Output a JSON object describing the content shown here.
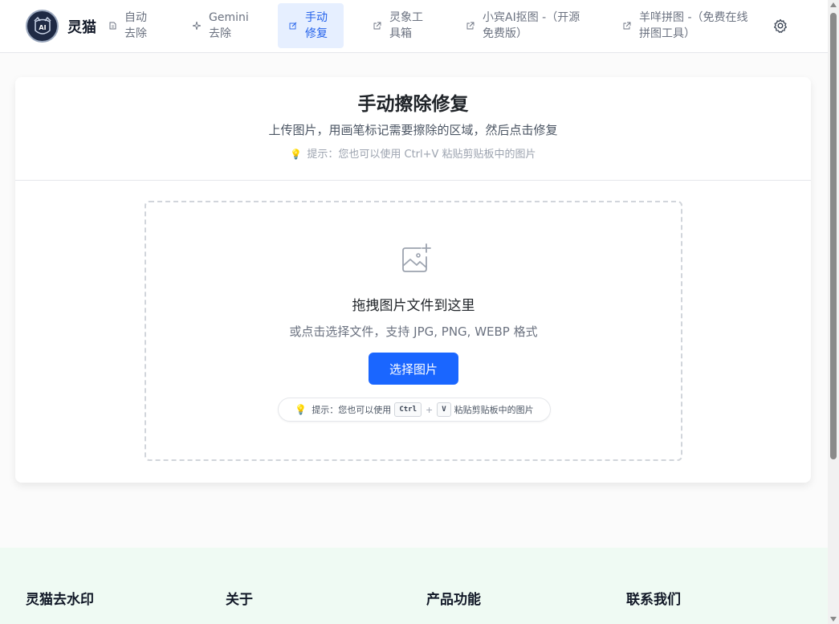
{
  "header": {
    "brand": "灵猫",
    "logo_text": "AI",
    "nav": [
      {
        "line1": "自动",
        "line2": "去除",
        "icon": "document-icon"
      },
      {
        "line1": "Gemini",
        "line2": "去除",
        "icon": "sparkle-icon"
      },
      {
        "line1": "手动",
        "line2": "修复",
        "icon": "edit-icon",
        "active": true
      },
      {
        "line1": "灵象工",
        "line2": "具箱",
        "icon": "external-link-icon"
      },
      {
        "line1": "小宾AI抠图 -（开源",
        "line2": "免费版）",
        "icon": "external-link-icon"
      },
      {
        "line1": "羊咩拼图 -（免费在线",
        "line2": "拼图工具）",
        "icon": "external-link-icon"
      }
    ]
  },
  "card": {
    "title": "手动擦除修复",
    "subtitle": "上传图片，用画笔标记需要擦除的区域，然后点击修复",
    "tip": "提示：您也可以使用 Ctrl+V 粘贴剪贴板中的图片"
  },
  "dropzone": {
    "title": "拖拽图片文件到这里",
    "subtitle": "或点击选择文件，支持 JPG, PNG, WEBP 格式",
    "button": "选择图片",
    "hint_prefix": "提示：您也可以使用",
    "key1": "Ctrl",
    "plus": "+",
    "key2": "V",
    "hint_suffix": "粘贴剪贴板中的图片"
  },
  "footer": {
    "columns": [
      "灵猫去水印",
      "关于",
      "产品功能",
      "联系我们"
    ]
  },
  "colors": {
    "accent": "#1a66ff",
    "active_nav_bg": "#e6efff",
    "footer_bg": "#effaf3"
  }
}
